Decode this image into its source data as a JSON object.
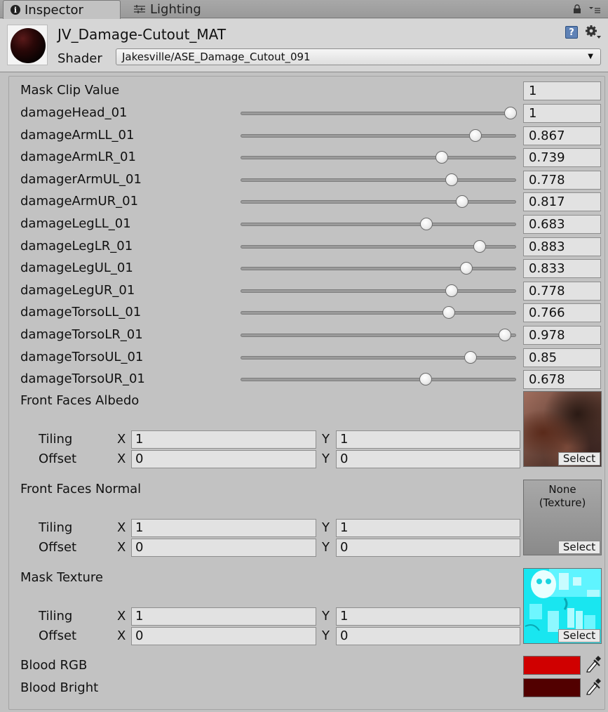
{
  "tabs": [
    {
      "label": "Inspector",
      "icon": "info-icon",
      "active": true
    },
    {
      "label": "Lighting",
      "icon": "lighting-icon",
      "active": false
    }
  ],
  "material": {
    "name": "JV_Damage-Cutout_MAT",
    "shader_label": "Shader",
    "shader_value": "Jakesville/ASE_Damage_Cutout_091"
  },
  "mask_clip": {
    "label": "Mask Clip Value",
    "value": "1"
  },
  "sliders": [
    {
      "label": "damageHead_01",
      "value": "1",
      "fraction": 1.0
    },
    {
      "label": "damageArmLL_01",
      "value": "0.867",
      "fraction": 0.867
    },
    {
      "label": "damageArmLR_01",
      "value": "0.739",
      "fraction": 0.739
    },
    {
      "label": "damagerArmUL_01",
      "value": "0.778",
      "fraction": 0.778
    },
    {
      "label": "damageArmUR_01",
      "value": "0.817",
      "fraction": 0.817
    },
    {
      "label": "damageLegLL_01",
      "value": "0.683",
      "fraction": 0.683
    },
    {
      "label": "damageLegLR_01",
      "value": "0.883",
      "fraction": 0.883
    },
    {
      "label": "damageLegUL_01",
      "value": "0.833",
      "fraction": 0.833
    },
    {
      "label": "damageLegUR_01",
      "value": "0.778",
      "fraction": 0.778
    },
    {
      "label": "damageTorsoLL_01",
      "value": "0.766",
      "fraction": 0.766
    },
    {
      "label": "damageTorsoLR_01",
      "value": "0.978",
      "fraction": 0.978
    },
    {
      "label": "damageTorsoUL_01",
      "value": "0.85",
      "fraction": 0.85
    },
    {
      "label": "damageTorsoUR_01",
      "value": "0.678",
      "fraction": 0.678
    }
  ],
  "textures": [
    {
      "label": "Front Faces Albedo",
      "tiling_label": "Tiling",
      "offset_label": "Offset",
      "x_label": "X",
      "y_label": "Y",
      "tiling_x": "1",
      "tiling_y": "1",
      "offset_x": "0",
      "offset_y": "0",
      "slot_text": "",
      "select_label": "Select"
    },
    {
      "label": "Front Faces Normal",
      "tiling_label": "Tiling",
      "offset_label": "Offset",
      "x_label": "X",
      "y_label": "Y",
      "tiling_x": "1",
      "tiling_y": "1",
      "offset_x": "0",
      "offset_y": "0",
      "slot_text_1": "None",
      "slot_text_2": "(Texture)",
      "select_label": "Select"
    },
    {
      "label": "Mask Texture",
      "tiling_label": "Tiling",
      "offset_label": "Offset",
      "x_label": "X",
      "y_label": "Y",
      "tiling_x": "1",
      "tiling_y": "1",
      "offset_x": "0",
      "offset_y": "0",
      "slot_text": "",
      "select_label": "Select"
    }
  ],
  "colors": [
    {
      "label": "Blood RGB",
      "hex": "#d00000"
    },
    {
      "label": "Blood Bright",
      "hex": "#520000"
    }
  ]
}
